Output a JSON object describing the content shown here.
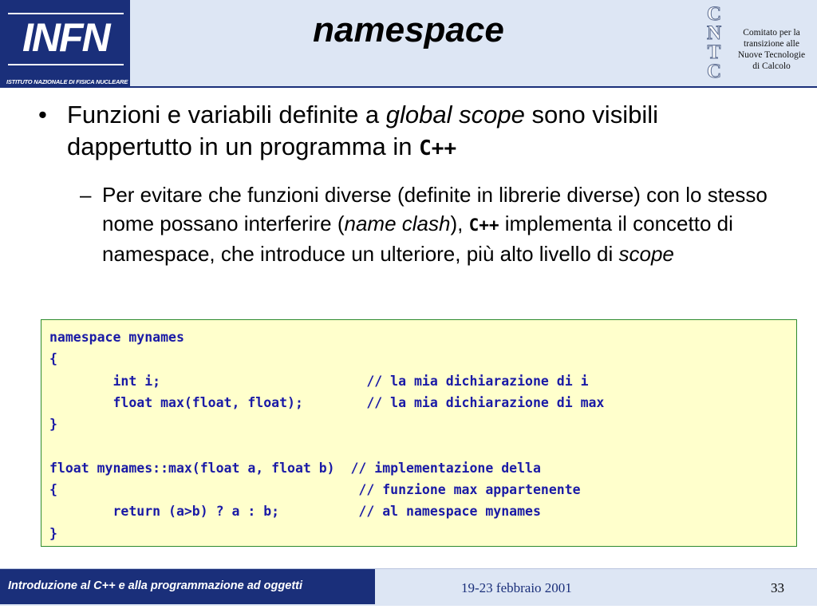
{
  "header": {
    "title": "namespace",
    "infn_logo": {
      "wordmark": "INFN",
      "subtitle": "ISTITUTO NAZIONALE DI FISICA NUCLEARE"
    },
    "cntc_logo": {
      "letters": [
        "C",
        "N",
        "T",
        "C"
      ],
      "text_lines": [
        "Comitato per la",
        "transizione alle",
        "Nuove Tecnologie",
        "di Calcolo"
      ]
    }
  },
  "bullet1": {
    "marker": "•",
    "part1": "Funzioni e variabili definite a ",
    "italic1": "global scope",
    "part2": " sono visibili dappertutto in un programma in ",
    "code": "C++"
  },
  "bullet2": {
    "marker": "–",
    "part1": "Per evitare che funzioni diverse (definite in librerie diverse) con lo stesso nome possano interferire (",
    "italic1": "name clash",
    "part2": "), ",
    "code": "C++",
    "part3": " implementa il concetto di namespace, che introduce un ulteriore, più alto livello di ",
    "italic2": "scope"
  },
  "code_block": {
    "lines": [
      "namespace mynames",
      "{",
      "        int i;                          // la mia dichiarazione di i",
      "        float max(float, float);        // la mia dichiarazione di max",
      "}",
      "",
      "float mynames::max(float a, float b)  // implementazione della",
      "{                                      // funzione max appartenente",
      "        return (a>b) ? a : b;          // al namespace mynames",
      "}"
    ]
  },
  "footer": {
    "course": "Introduzione al C++ e alla programmazione ad oggetti",
    "date": "19-23 febbraio 2001",
    "page": "33"
  },
  "colors": {
    "navy": "#1a2f7a",
    "header_bg": "#dde6f4",
    "code_bg": "#ffffcc",
    "code_text": "#1a1aa6",
    "code_border": "#2e8b2e"
  }
}
